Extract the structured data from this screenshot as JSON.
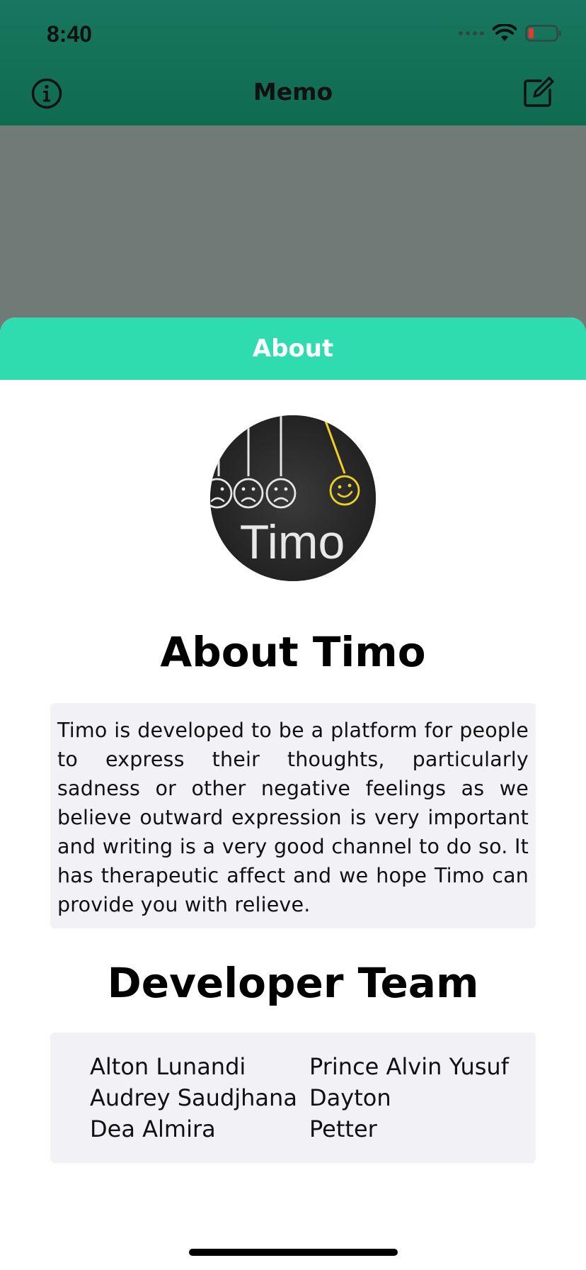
{
  "status_bar": {
    "time": "8:40"
  },
  "nav": {
    "title": "Memo",
    "left_icon": "info-icon",
    "right_icon": "compose-icon"
  },
  "sheet": {
    "header": "About",
    "logo_text": "Timo",
    "about_title": "About Timo",
    "about_text": "Timo is developed to be a platform for people to express their thoughts, particularly sadness or other negative feelings as we believe outward expression is very important and writing is a very good channel to do so. It has therapeutic affect and we hope Timo can provide you with relieve.",
    "developer_title": "Developer Team",
    "team_left": [
      "Alton Lunandi",
      "Audrey Saudjhana",
      "Dea Almira"
    ],
    "team_right": [
      "Prince Alvin Yusuf",
      "Dayton",
      "Petter"
    ]
  },
  "colors": {
    "header_green": "#0f6b50",
    "sheet_header": "#2edcaf",
    "dim_overlay": "#707a76",
    "box_bg": "#f1f1f6"
  }
}
